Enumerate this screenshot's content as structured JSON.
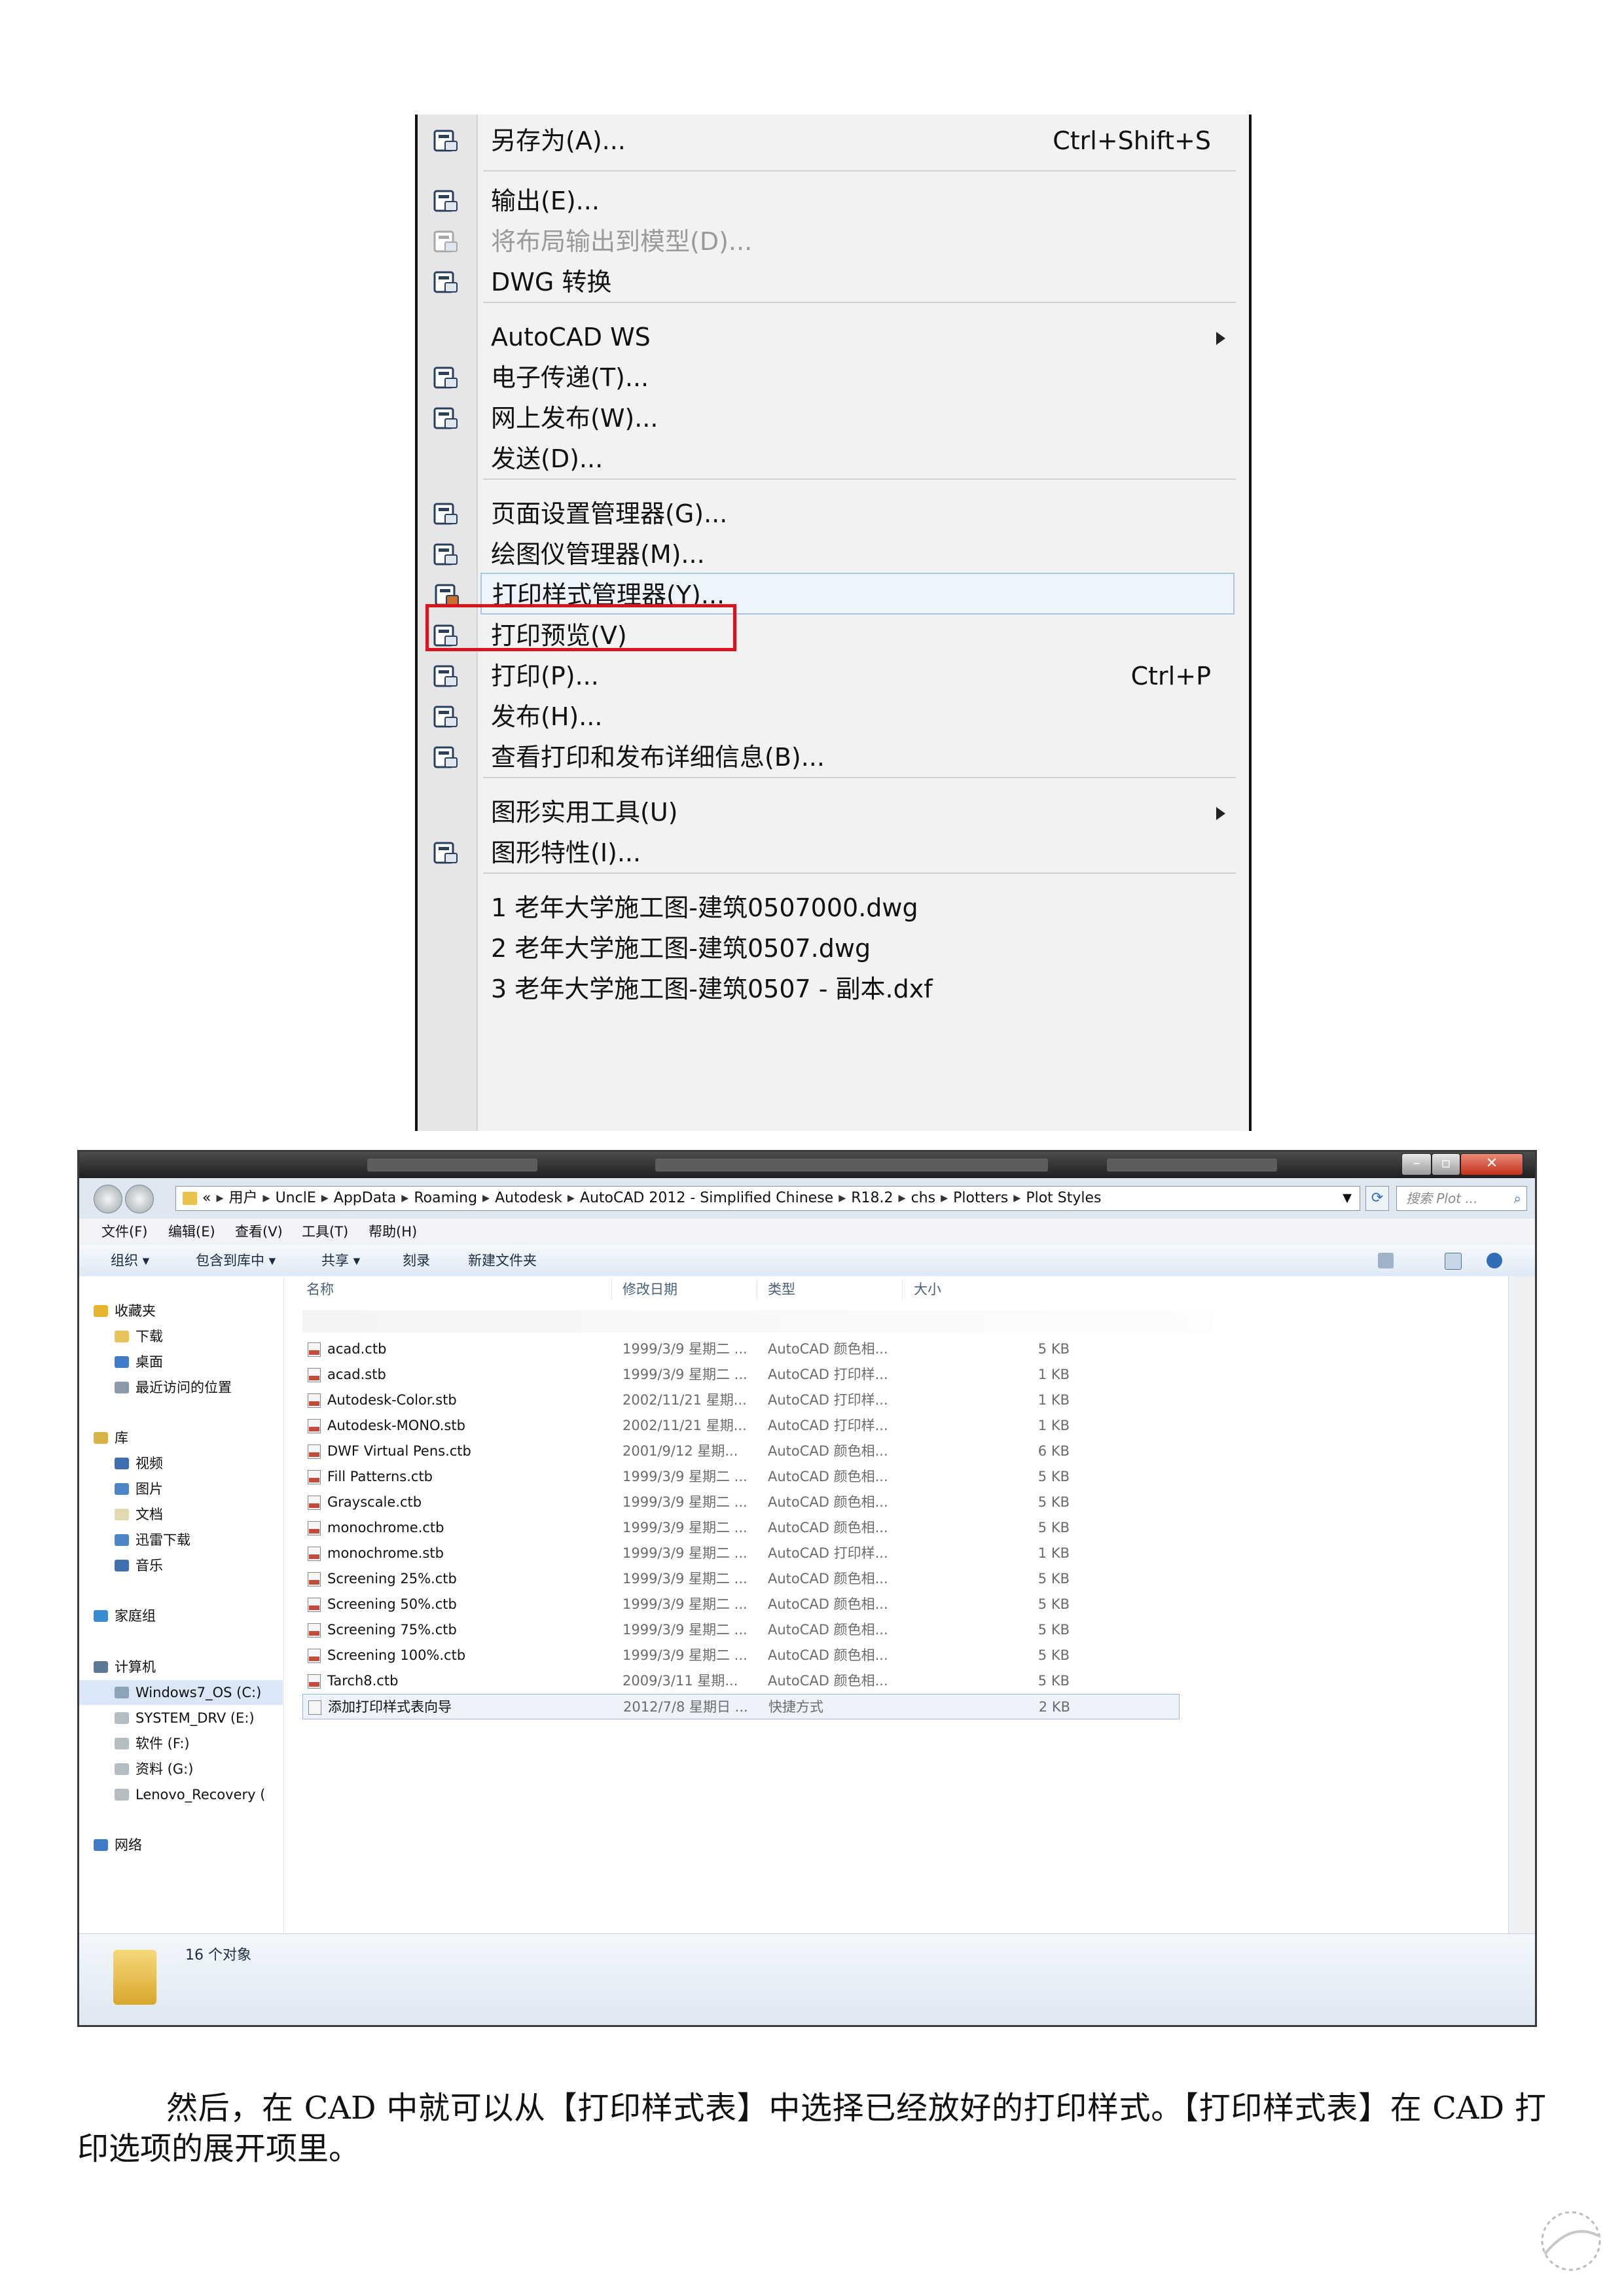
{
  "cad_menu": {
    "items": [
      {
        "label": "另存为(A)...",
        "shortcut": "Ctrl+Shift+S",
        "icon": "save-as-icon"
      },
      {
        "label": "输出(E)...",
        "icon": "export-icon"
      },
      {
        "label": "将布局输出到模型(D)...",
        "icon": "export-layout-icon",
        "disabled": true
      },
      {
        "label": "DWG 转换",
        "icon": "dwg-convert-icon"
      },
      {
        "label": "AutoCAD WS",
        "submenu": true
      },
      {
        "label": "电子传递(T)...",
        "icon": "etransmit-icon"
      },
      {
        "label": "网上发布(W)...",
        "icon": "publish-web-icon"
      },
      {
        "label": "发送(D)..."
      },
      {
        "label": "页面设置管理器(G)...",
        "icon": "page-setup-icon"
      },
      {
        "label": "绘图仪管理器(M)...",
        "icon": "plotter-manager-icon"
      },
      {
        "label": "打印样式管理器(Y)...",
        "icon": "plot-style-manager-icon",
        "highlighted": true
      },
      {
        "label": "打印预览(V)",
        "icon": "plot-preview-icon"
      },
      {
        "label": "打印(P)...",
        "shortcut": "Ctrl+P",
        "icon": "print-icon"
      },
      {
        "label": "发布(H)...",
        "icon": "publish-icon"
      },
      {
        "label": "查看打印和发布详细信息(B)...",
        "icon": "plot-details-icon"
      },
      {
        "label": "图形实用工具(U)",
        "submenu": true
      },
      {
        "label": "图形特性(I)...",
        "icon": "drawing-properties-icon"
      },
      {
        "label": "1 老年大学施工图-建筑0507000.dwg"
      },
      {
        "label": "2 老年大学施工图-建筑0507.dwg"
      },
      {
        "label": "3 老年大学施工图-建筑0507 - 副本.dxf"
      }
    ],
    "highlight_color": "#d9141c"
  },
  "explorer": {
    "address": [
      "«",
      "用户",
      "UnclE",
      "AppData",
      "Roaming",
      "Autodesk",
      "AutoCAD 2012 - Simplified Chinese",
      "R18.2",
      "chs",
      "Plotters",
      "Plot Styles"
    ],
    "search_placeholder": "搜索 Plot ...",
    "menu": [
      "文件(F)",
      "编辑(E)",
      "查看(V)",
      "工具(T)",
      "帮助(H)"
    ],
    "toolbar": [
      "组织 ▾",
      "包含到库中 ▾",
      "共享 ▾",
      "刻录",
      "新建文件夹"
    ],
    "nav": [
      {
        "label": "收藏夹",
        "icon": "star-icon"
      },
      {
        "label": "下载",
        "icon": "download-folder-icon"
      },
      {
        "label": "桌面",
        "icon": "desktop-icon"
      },
      {
        "label": "最近访问的位置",
        "icon": "recent-places-icon"
      },
      {
        "label": "库",
        "icon": "library-icon"
      },
      {
        "label": "视频",
        "icon": "video-icon"
      },
      {
        "label": "图片",
        "icon": "pictures-icon"
      },
      {
        "label": "文档",
        "icon": "documents-icon"
      },
      {
        "label": "迅雷下载",
        "icon": "thunder-download-icon"
      },
      {
        "label": "音乐",
        "icon": "music-icon"
      },
      {
        "label": "家庭组",
        "icon": "homegroup-icon"
      },
      {
        "label": "计算机",
        "icon": "computer-icon"
      },
      {
        "label": "Windows7_OS (C:)",
        "icon": "drive-c-icon"
      },
      {
        "label": "SYSTEM_DRV (E:)",
        "icon": "drive-icon"
      },
      {
        "label": "软件 (F:)",
        "icon": "drive-icon"
      },
      {
        "label": "资料 (G:)",
        "icon": "drive-icon"
      },
      {
        "label": "Lenovo_Recovery (",
        "icon": "drive-icon"
      },
      {
        "label": "网络",
        "icon": "network-icon"
      }
    ],
    "columns": [
      "名称",
      "修改日期",
      "类型",
      "大小"
    ],
    "files": [
      {
        "name": "acad.ctb",
        "date": "1999/3/9 星期二 ...",
        "type": "AutoCAD 颜色相...",
        "size": "5 KB"
      },
      {
        "name": "acad.stb",
        "date": "1999/3/9 星期二 ...",
        "type": "AutoCAD 打印样...",
        "size": "1 KB"
      },
      {
        "name": "Autodesk-Color.stb",
        "date": "2002/11/21 星期...",
        "type": "AutoCAD 打印样...",
        "size": "1 KB"
      },
      {
        "name": "Autodesk-MONO.stb",
        "date": "2002/11/21 星期...",
        "type": "AutoCAD 打印样...",
        "size": "1 KB"
      },
      {
        "name": "DWF Virtual Pens.ctb",
        "date": "2001/9/12 星期...",
        "type": "AutoCAD 颜色相...",
        "size": "6 KB"
      },
      {
        "name": "Fill Patterns.ctb",
        "date": "1999/3/9 星期二 ...",
        "type": "AutoCAD 颜色相...",
        "size": "5 KB"
      },
      {
        "name": "Grayscale.ctb",
        "date": "1999/3/9 星期二 ...",
        "type": "AutoCAD 颜色相...",
        "size": "5 KB"
      },
      {
        "name": "monochrome.ctb",
        "date": "1999/3/9 星期二 ...",
        "type": "AutoCAD 颜色相...",
        "size": "5 KB"
      },
      {
        "name": "monochrome.stb",
        "date": "1999/3/9 星期二 ...",
        "type": "AutoCAD 打印样...",
        "size": "1 KB"
      },
      {
        "name": "Screening 25%.ctb",
        "date": "1999/3/9 星期二 ...",
        "type": "AutoCAD 颜色相...",
        "size": "5 KB"
      },
      {
        "name": "Screening 50%.ctb",
        "date": "1999/3/9 星期二 ...",
        "type": "AutoCAD 颜色相...",
        "size": "5 KB"
      },
      {
        "name": "Screening 75%.ctb",
        "date": "1999/3/9 星期二 ...",
        "type": "AutoCAD 颜色相...",
        "size": "5 KB"
      },
      {
        "name": "Screening 100%.ctb",
        "date": "1999/3/9 星期二 ...",
        "type": "AutoCAD 颜色相...",
        "size": "5 KB"
      },
      {
        "name": "Tarch8.ctb",
        "date": "2009/3/11 星期...",
        "type": "AutoCAD 颜色相...",
        "size": "5 KB"
      },
      {
        "name": "添加打印样式表向导",
        "date": "2012/7/8 星期日 ...",
        "type": "快捷方式",
        "size": "2 KB",
        "selected": true
      }
    ],
    "status": "16 个对象"
  },
  "paragraph": "然后，在 CAD 中就可以从【打印样式表】中选择已经放好的打印样式。【打印样式表】在 CAD 打印选项的展开项里。"
}
